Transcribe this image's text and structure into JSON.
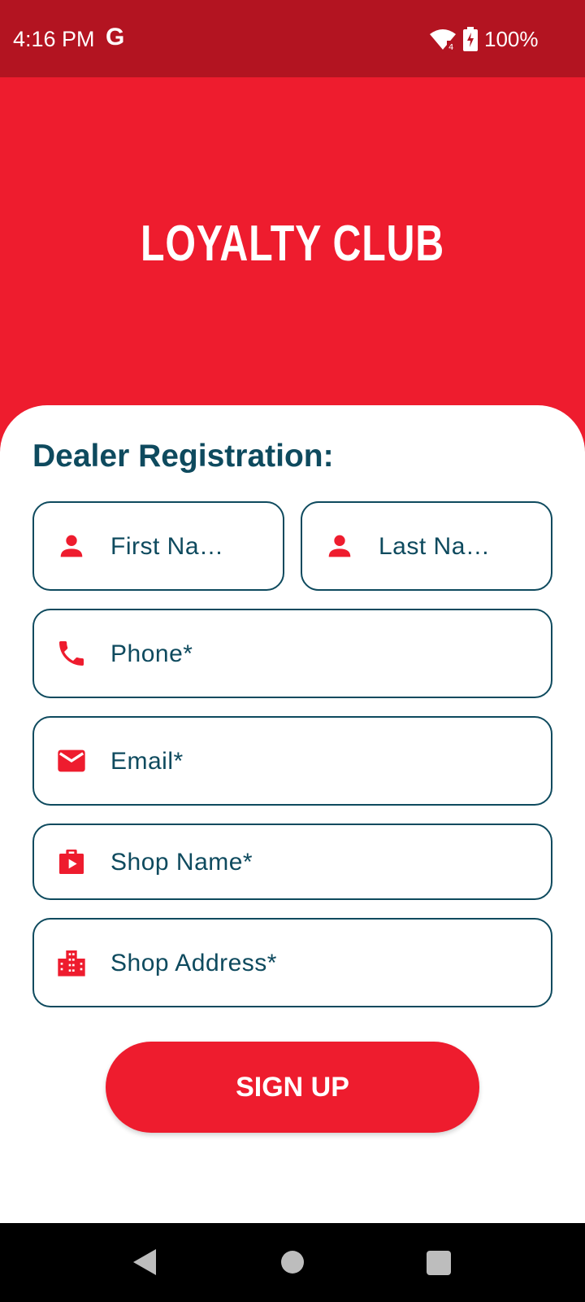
{
  "status_bar": {
    "time": "4:16 PM",
    "g_label": "G",
    "battery": "100%",
    "background_color": "#B31421"
  },
  "header": {
    "title": "LOYALTY CLUB",
    "background_color": "#EE1C2E"
  },
  "form": {
    "title": "Dealer Registration:",
    "fields": {
      "first_name": {
        "label": "First Na…",
        "icon": "person-icon"
      },
      "last_name": {
        "label": "Last Na…",
        "icon": "person-icon"
      },
      "phone": {
        "label": "Phone*",
        "icon": "phone-icon"
      },
      "email": {
        "label": "Email*",
        "icon": "mail-icon"
      },
      "shop_name": {
        "label": "Shop Name*",
        "icon": "shop-bag-icon"
      },
      "shop_address": {
        "label": "Shop Address*",
        "icon": "building-icon"
      }
    },
    "submit_label": "SIGN UP",
    "accent_color": "#EE1C2E",
    "text_color": "#0E4A5E"
  },
  "nav_bar": {
    "buttons": [
      "back-icon",
      "home-icon",
      "recent-apps-icon"
    ]
  }
}
